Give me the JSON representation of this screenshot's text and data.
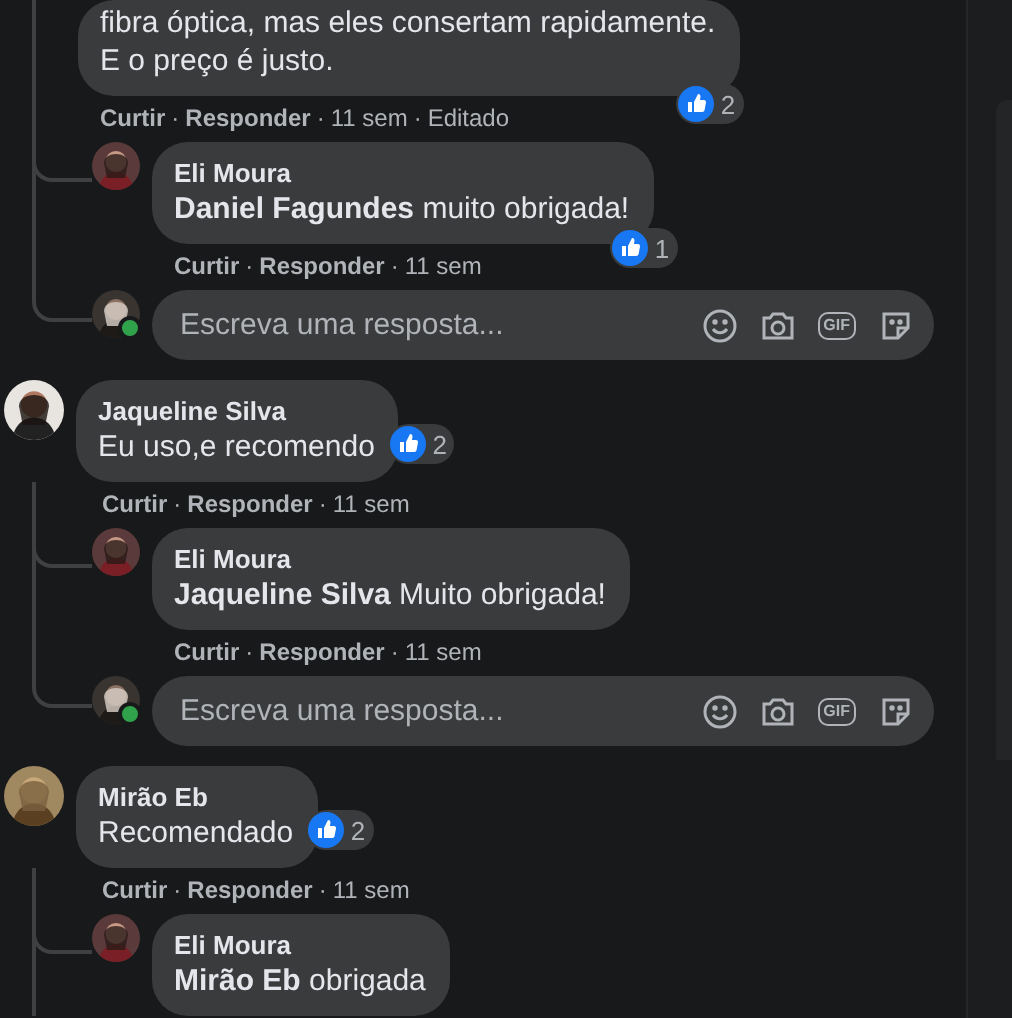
{
  "comments": [
    {
      "lines": [
        "fibra óptica, mas eles consertam rapidamente.",
        "E o preço é justo."
      ],
      "reactions": "2",
      "actions": {
        "like": "Curtir",
        "sep": "·",
        "reply": "Responder",
        "time": "11 sem",
        "edited": "Editado"
      },
      "replies": [
        {
          "author": "Eli Moura",
          "text": "**Daniel Fagundes** muito obrigada!",
          "reactions": "1",
          "actions": {
            "like": "Curtir",
            "sep": "·",
            "reply": "Responder",
            "time": "11 sem"
          }
        }
      ],
      "reply_box": {
        "placeholder": "Escreva uma resposta...",
        "online": true,
        "gif": "GIF"
      }
    },
    {
      "author": "Jaqueline Silva",
      "lines": [
        "Eu uso,e recomendo"
      ],
      "reactions": "2",
      "actions": {
        "like": "Curtir",
        "sep": "·",
        "reply": "Responder",
        "time": "11 sem"
      },
      "replies": [
        {
          "author": "Eli Moura",
          "text": "**Jaqueline Silva** Muito obrigada!",
          "actions": {
            "like": "Curtir",
            "sep": "·",
            "reply": "Responder",
            "time": "11 sem"
          }
        }
      ],
      "reply_box": {
        "placeholder": "Escreva uma resposta...",
        "online": true,
        "gif": "GIF"
      }
    },
    {
      "author": "Mirão Eb",
      "lines": [
        "Recomendado"
      ],
      "reactions": "2",
      "actions": {
        "like": "Curtir",
        "sep": "·",
        "reply": "Responder",
        "time": "11 sem"
      },
      "replies": [
        {
          "author": "Eli Moura",
          "text": "**Mirão Eb** obrigada"
        }
      ]
    }
  ]
}
